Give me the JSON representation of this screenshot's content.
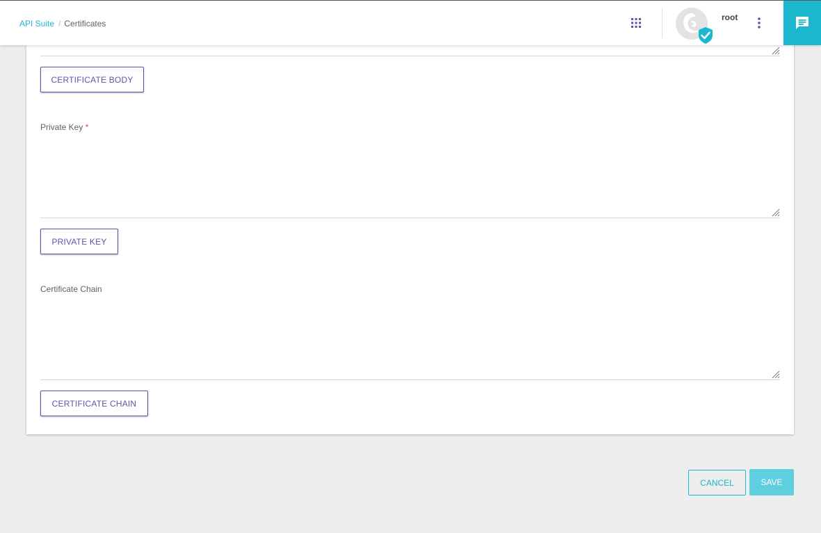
{
  "breadcrumb": {
    "root": "API Suite",
    "separator": "/",
    "current": "Certificates"
  },
  "header": {
    "apps_icon": "apps-grid-icon",
    "avatar_icon": "verified-avatar-icon",
    "username": "root",
    "menu_icon": "more-vertical-icon",
    "chat_icon": "chat-icon"
  },
  "form": {
    "certificate_body_button": "CERTIFICATE BODY",
    "private_key_label": "Private Key",
    "private_key_required": "*",
    "private_key_button": "PRIVATE KEY",
    "certificate_chain_label": "Certificate Chain",
    "certificate_chain_button": "CERTIFICATE CHAIN"
  },
  "actions": {
    "cancel": "CANCEL",
    "save": "SAVE"
  },
  "colors": {
    "accent": "#1bb7cf",
    "primary": "#5f52a8",
    "background": "#eeeeee",
    "required": "#e53935"
  }
}
